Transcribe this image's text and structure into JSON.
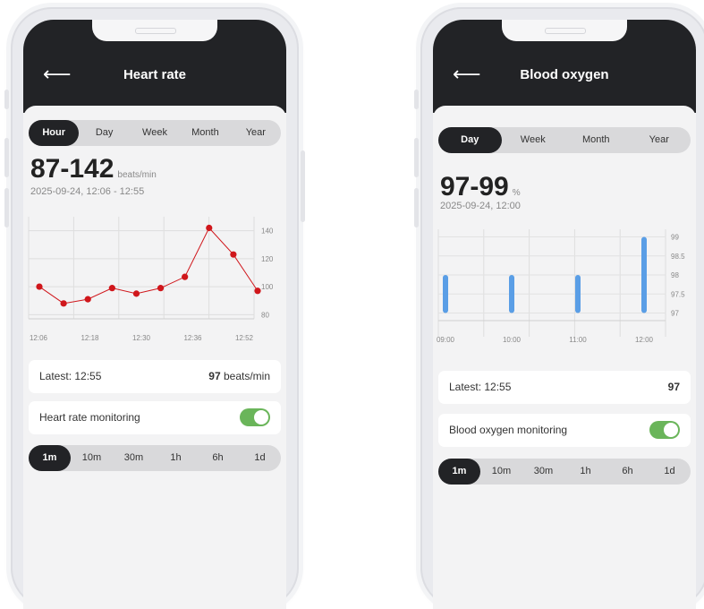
{
  "left_screen": {
    "title": "Heart rate",
    "period_tabs": [
      "Hour",
      "Day",
      "Week",
      "Month",
      "Year"
    ],
    "range_value": "87-142",
    "range_unit": "beats/min",
    "date_range": "2025-09-24, 12:06 - 12:55",
    "latest_label": "Latest: 12:55",
    "latest_value": "97",
    "latest_unit": " beats/min",
    "monitoring_label": "Heart rate monitoring",
    "monitoring_on": true,
    "interval_tabs": [
      "1m",
      "10m",
      "30m",
      "1h",
      "6h",
      "1d"
    ]
  },
  "right_screen": {
    "title": "Blood oxygen",
    "period_tabs": [
      "Day",
      "Week",
      "Month",
      "Year"
    ],
    "range_value": "97-99",
    "range_unit": "%",
    "date_range": "2025-09-24, 12:00",
    "latest_label": "Latest: 12:55",
    "latest_value": "97",
    "monitoring_label": "Blood oxygen monitoring",
    "monitoring_on": true,
    "interval_tabs": [
      "1m",
      "10m",
      "30m",
      "1h",
      "6h",
      "1d"
    ]
  },
  "colors": {
    "dark": "#222326",
    "toggle_green": "#6ab55a",
    "heart_line": "#d0161b",
    "oxygen_bar": "#5a9ee6"
  },
  "chart_data": [
    {
      "type": "line",
      "x": [
        "12:06",
        "12:12",
        "12:18",
        "12:24",
        "12:30",
        "12:36",
        "12:42",
        "12:48",
        "12:54"
      ],
      "values": [
        100,
        88,
        91,
        99,
        95,
        99,
        107,
        142,
        123,
        97
      ],
      "x_full": [
        "12:06",
        "12:11",
        "12:17",
        "12:22",
        "12:28",
        "12:33",
        "12:39",
        "12:44",
        "12:50",
        "12:55"
      ],
      "xtick_labels": [
        "12:06",
        "12:18",
        "12:30",
        "12:36",
        "12:52"
      ],
      "ytick_labels": [
        "140",
        "120",
        "100",
        "80"
      ],
      "ylim": [
        77,
        150
      ],
      "grid": true
    },
    {
      "type": "bar",
      "categories": [
        "09:00",
        "10:00",
        "11:00",
        "12:00"
      ],
      "ranges": [
        [
          97,
          98
        ],
        [
          97,
          98
        ],
        [
          97,
          98
        ],
        [
          97,
          99
        ]
      ],
      "ytick_labels": [
        "99",
        "98.5",
        "98",
        "97.5",
        "97"
      ],
      "ylim": [
        96.8,
        99.2
      ],
      "grid": true
    }
  ]
}
